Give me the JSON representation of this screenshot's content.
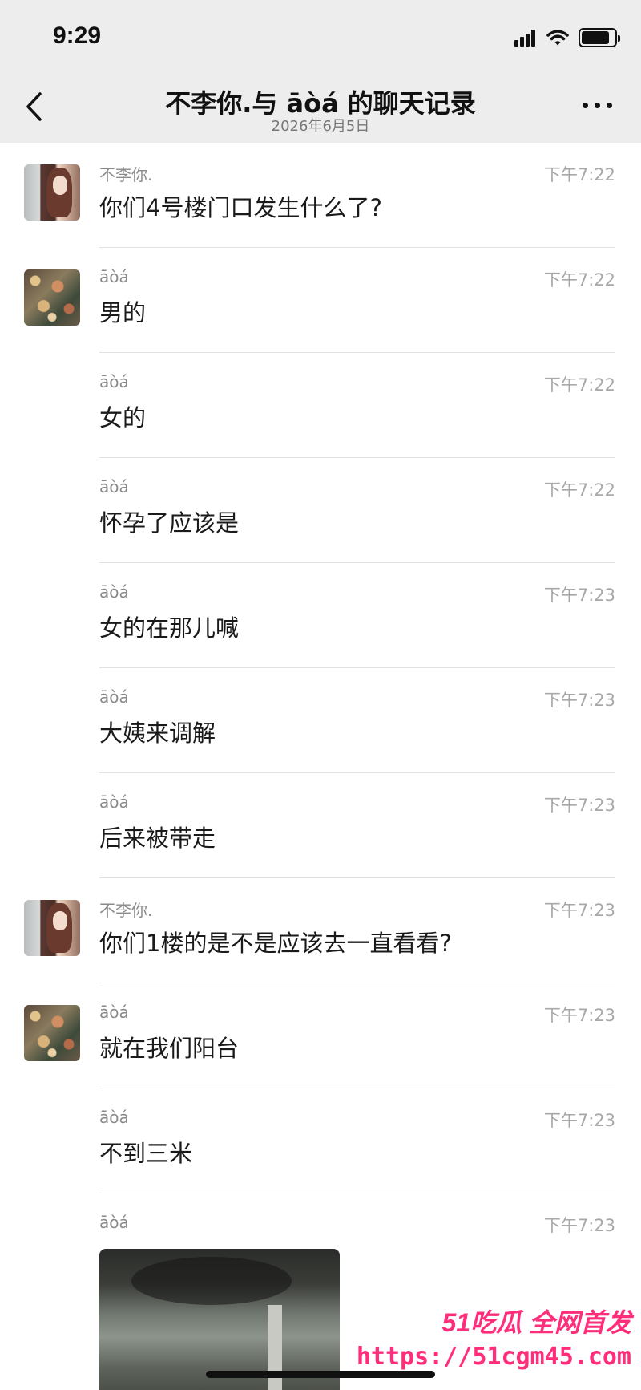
{
  "status_bar": {
    "time": "9:29",
    "battery_level": 0.85
  },
  "header": {
    "title": "不李你.与 āòá 的聊天记录",
    "subtitle": "2026年6月5日"
  },
  "messages": [
    {
      "sender": "不李你.",
      "time": "下午7:22",
      "text": "你们4号楼门口发生什么了?",
      "avatar": "girl"
    },
    {
      "sender": "āòá",
      "time": "下午7:22",
      "text": "男的",
      "avatar": "collage"
    },
    {
      "sender": "āòá",
      "time": "下午7:22",
      "text": "女的",
      "avatar": ""
    },
    {
      "sender": "āòá",
      "time": "下午7:22",
      "text": "怀孕了应该是",
      "avatar": ""
    },
    {
      "sender": "āòá",
      "time": "下午7:23",
      "text": "女的在那儿喊",
      "avatar": ""
    },
    {
      "sender": "āòá",
      "time": "下午7:23",
      "text": "大姨来调解",
      "avatar": ""
    },
    {
      "sender": "āòá",
      "time": "下午7:23",
      "text": "后来被带走",
      "avatar": ""
    },
    {
      "sender": "不李你.",
      "time": "下午7:23",
      "text": "你们1楼的是不是应该去一直看看?",
      "avatar": "girl"
    },
    {
      "sender": "āòá",
      "time": "下午7:23",
      "text": "就在我们阳台",
      "avatar": "collage"
    },
    {
      "sender": "āòá",
      "time": "下午7:23",
      "text": "不到三米",
      "avatar": ""
    },
    {
      "sender": "āòá",
      "time": "下午7:23",
      "text": "",
      "avatar": ""
    }
  ],
  "watermark": {
    "brand": "51吃瓜 全网首发",
    "url": "https://51cgm45.com"
  },
  "icons": {
    "back": "chevron-left-icon",
    "more": "more-icon"
  }
}
